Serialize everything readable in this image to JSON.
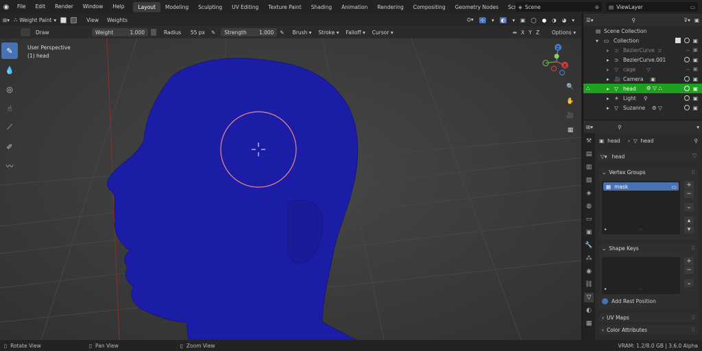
{
  "topbar": {
    "menu": [
      "File",
      "Edit",
      "Render",
      "Window",
      "Help"
    ],
    "workspaces": [
      "Layout",
      "Modeling",
      "Sculpting",
      "UV Editing",
      "Texture Paint",
      "Shading",
      "Animation",
      "Rendering",
      "Compositing",
      "Geometry Nodes",
      "Scripting"
    ],
    "active_workspace": "Layout",
    "scene": "Scene",
    "view_layer": "ViewLayer"
  },
  "header": {
    "mode": "Weight Paint",
    "view": "View",
    "weights": "Weights"
  },
  "tool_settings": {
    "brush_name": "Draw",
    "weight_label": "Weight",
    "weight_value": "1.000",
    "radius_label": "Radius",
    "radius_value": "55 px",
    "strength_label": "Strength",
    "strength_value": "1.000",
    "brush": "Brush",
    "stroke": "Stroke",
    "falloff": "Falloff",
    "cursor": "Cursor",
    "options": "Options",
    "xyz": [
      "X",
      "Y",
      "Z"
    ]
  },
  "viewport": {
    "perspective": "User Perspective",
    "object": "(1) head",
    "mesh_color": "#1c1da6",
    "gizmo_axes": [
      "X",
      "Y",
      "Z"
    ]
  },
  "outliner": {
    "root": "Scene Collection",
    "collection": "Collection",
    "items": [
      {
        "name": "BezierCurve",
        "dim": true
      },
      {
        "name": "BezierCurve.001",
        "dim": false
      },
      {
        "name": "cage",
        "dim": true
      },
      {
        "name": "Camera",
        "dim": false
      },
      {
        "name": "head",
        "dim": false,
        "selected": true
      },
      {
        "name": "Light",
        "dim": false
      },
      {
        "name": "Suzanne",
        "dim": false
      }
    ]
  },
  "properties": {
    "breadcrumb_object": "head",
    "breadcrumb_data": "head",
    "data_name": "head",
    "vertex_groups_title": "Vertex Groups",
    "vertex_group_items": [
      "mask"
    ],
    "shape_keys_title": "Shape Keys",
    "add_rest_position": "Add Rest Position",
    "uv_maps_title": "UV Maps",
    "color_attributes_title": "Color Attributes"
  },
  "statusbar": {
    "rotate": "Rotate View",
    "pan": "Pan View",
    "zoom": "Zoom View",
    "vram": "VRAM: 1.2/8.0 GB | 3.6.0 Alpha"
  }
}
